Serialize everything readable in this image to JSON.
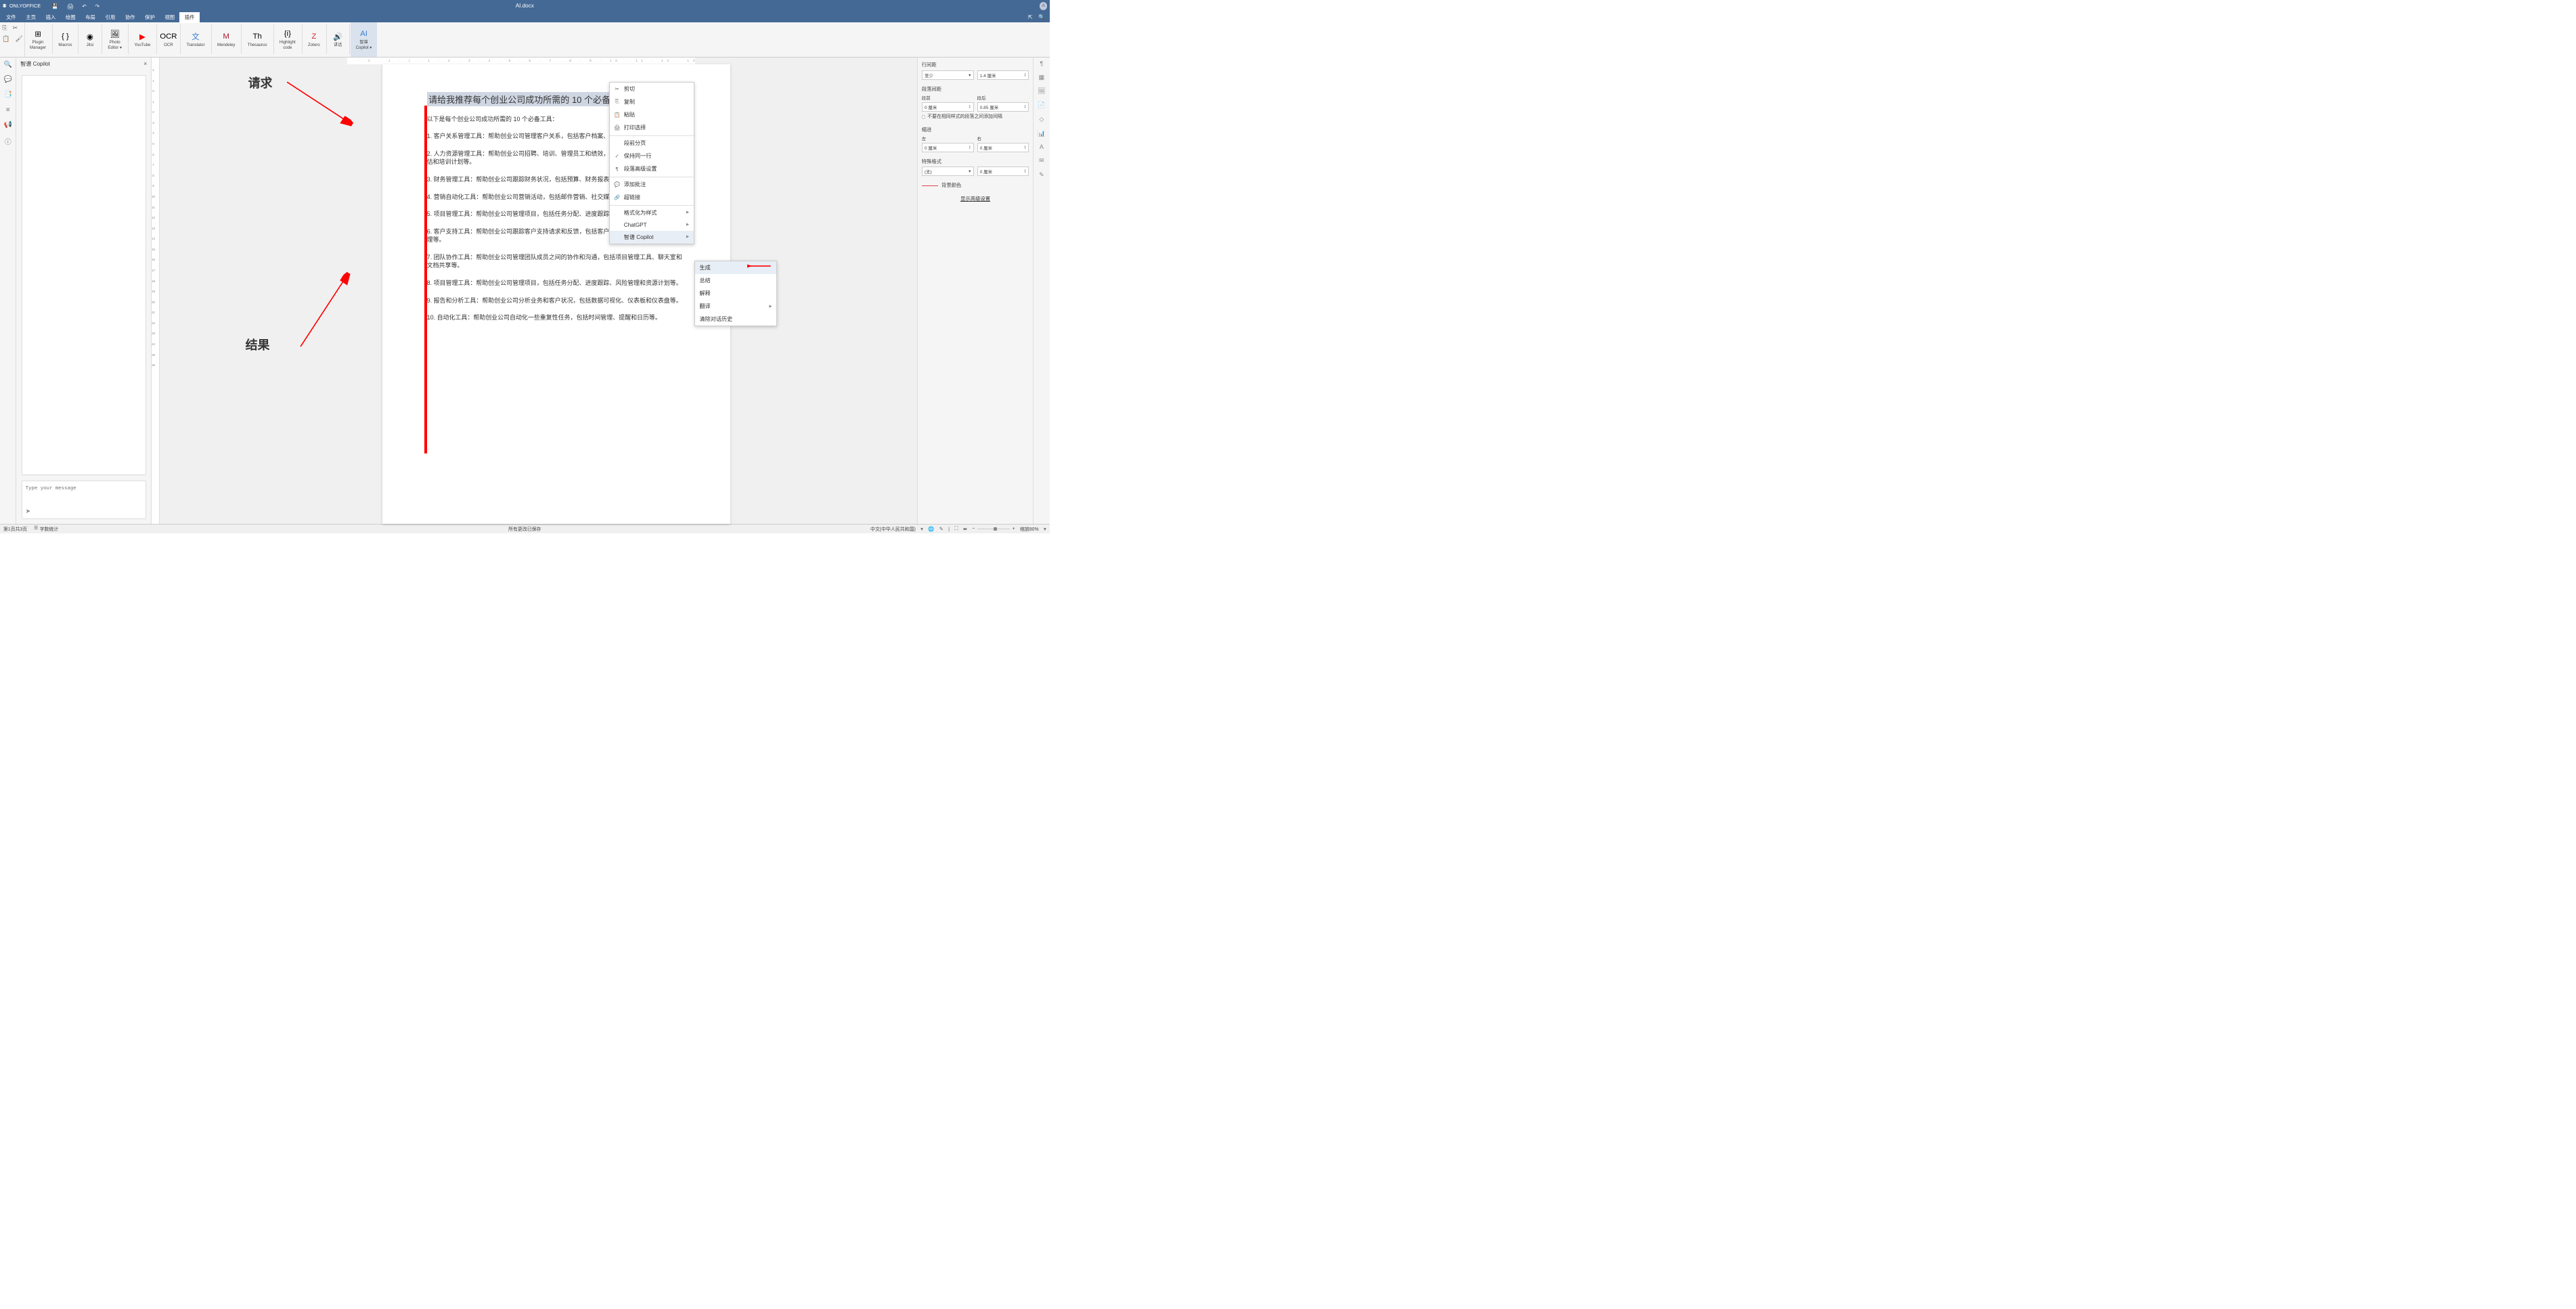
{
  "app": {
    "name": "ONLYOFFICE",
    "doc_title": "AI.docx",
    "avatar": "A"
  },
  "menu": {
    "items": [
      "文件",
      "主页",
      "插入",
      "绘图",
      "布局",
      "引用",
      "协作",
      "保护",
      "视图",
      "插件"
    ],
    "active_index": 9
  },
  "toolbar_small": {
    "copy": "copy",
    "cut": "cut",
    "paste": "paste",
    "fmt": "fmt"
  },
  "plugins": [
    {
      "icon": "⊞",
      "label": "Plugin\nManager"
    },
    {
      "icon": "{ }",
      "label": "Macros"
    },
    {
      "icon": "◉",
      "label": "Jitsi"
    },
    {
      "icon": "🖼",
      "label": "Photo\nEditor ▾"
    },
    {
      "icon": "▶",
      "label": "YouTube",
      "color": "#ff0000"
    },
    {
      "icon": "OCR",
      "label": "OCR"
    },
    {
      "icon": "文",
      "label": "Translator",
      "color": "#3a7bd5"
    },
    {
      "icon": "M",
      "label": "Mendeley",
      "color": "#a6192e"
    },
    {
      "icon": "Th",
      "label": "Thesaurus"
    },
    {
      "icon": "{i}",
      "label": "Highlight\ncode"
    },
    {
      "icon": "Z",
      "label": "Zotero",
      "color": "#cc2936"
    },
    {
      "icon": "🔊",
      "label": "讲话"
    },
    {
      "icon": "AI",
      "label": "智谱\nCopilot ▾",
      "color": "#3a7bd5",
      "active": true
    }
  ],
  "side_panel": {
    "title": "智谱 Copilot",
    "close": "×",
    "placeholder": "Type your message"
  },
  "annotations": {
    "request": "请求",
    "result": "结果"
  },
  "document": {
    "prompt": "请给我推荐每个创业公司成功所需的 10 个必备工具",
    "intro": "以下是每个创业公司成功所需的 10 个必备工具：",
    "items": [
      "1. 客户关系管理工具：帮助创业公司管理客户关系，包括客户档案、销售和营销活动和投诉等。",
      "2. 人力资源管理工具：帮助创业公司招聘、培训、管理员工和绩效，包括员工档案计划、绩效评估和培训计划等。",
      "3. 财务管理工具：帮助创业公司跟踪财务状况，包括预算、财务报表、支付和收款。",
      "4. 营销自动化工具：帮助创业公司营销活动，包括邮件营销、社交媒体营销、搜索告等。",
      "5. 项目管理工具：帮助创业公司管理项目，包括任务分配、进度跟踪、风险管理和资源计划等。",
      "6. 客户支持工具：帮助创业公司跟踪客户支持请求和反馈，包括客户服务软件、知识库和社区管理等。",
      "7. 团队协作工具：帮助创业公司管理团队成员之间的协作和沟通，包括项目管理工具、聊天室和文档共享等。",
      "8. 项目管理工具：帮助创业公司管理项目，包括任务分配、进度跟踪、风险管理和资源计划等。",
      "9. 报告和分析工具：帮助创业公司分析业务和客户状况，包括数据可视化、仪表板和仪表盘等。",
      "10. 自动化工具：帮助创业公司自动化一些重复性任务，包括时间管理、提醒和日历等。"
    ]
  },
  "context_menu": {
    "items": [
      {
        "icon": "✂",
        "label": "剪切"
      },
      {
        "icon": "⎘",
        "label": "复制"
      },
      {
        "icon": "📋",
        "label": "粘贴"
      },
      {
        "icon": "🖨",
        "label": "打印选择"
      },
      {
        "sep": true
      },
      {
        "icon": "",
        "label": "段前分页"
      },
      {
        "icon": "✓",
        "label": "保持同一行"
      },
      {
        "icon": "¶",
        "label": "段落高级设置"
      },
      {
        "sep": true
      },
      {
        "icon": "💬",
        "label": "添加批注"
      },
      {
        "icon": "🔗",
        "label": "超链接"
      },
      {
        "sep": true
      },
      {
        "icon": "",
        "label": "格式化为样式",
        "arrow": true
      },
      {
        "icon": "",
        "label": "ChatGPT",
        "arrow": true
      },
      {
        "icon": "",
        "label": "智谱 Copilot",
        "arrow": true,
        "hover": true
      }
    ],
    "submenu": [
      {
        "label": "生成",
        "hover": true
      },
      {
        "label": "总结"
      },
      {
        "label": "解释"
      },
      {
        "label": "翻译",
        "arrow": true
      },
      {
        "label": "清除对话历史"
      }
    ]
  },
  "right_panel": {
    "line_spacing": {
      "label": "行间距",
      "mode": "至少",
      "value": "1.4 厘米"
    },
    "para_spacing": {
      "label": "段落间距",
      "before_label": "段前",
      "before": "0 厘米",
      "after_label": "段后",
      "after": "0.85 厘米"
    },
    "checkbox": "不要在相同样式的段落之间添加间隔",
    "indent": {
      "label": "缩进",
      "left_label": "左",
      "left": "0 厘米",
      "right_label": "右",
      "right": "0 厘米"
    },
    "special": {
      "label": "特殊格式",
      "mode": "(无)",
      "value": "0 厘米"
    },
    "bg": {
      "label": "背景颜色"
    },
    "adv": "显示高级设置"
  },
  "status": {
    "page": "第1页共3页",
    "wc_icon": "☰",
    "wc": "字数统计",
    "save_msg": "所有更改已保存",
    "lang": "中文(中华人民共和国)",
    "zoom": "缩放80%"
  },
  "ruler": "· 2 · 1 · | · 1 · 2 · 3 · 4 · 5 · 6 · 7 · 8 · 9 · 10 · 11 · 12 · 13 · 14 · 15 · 16 · 17"
}
